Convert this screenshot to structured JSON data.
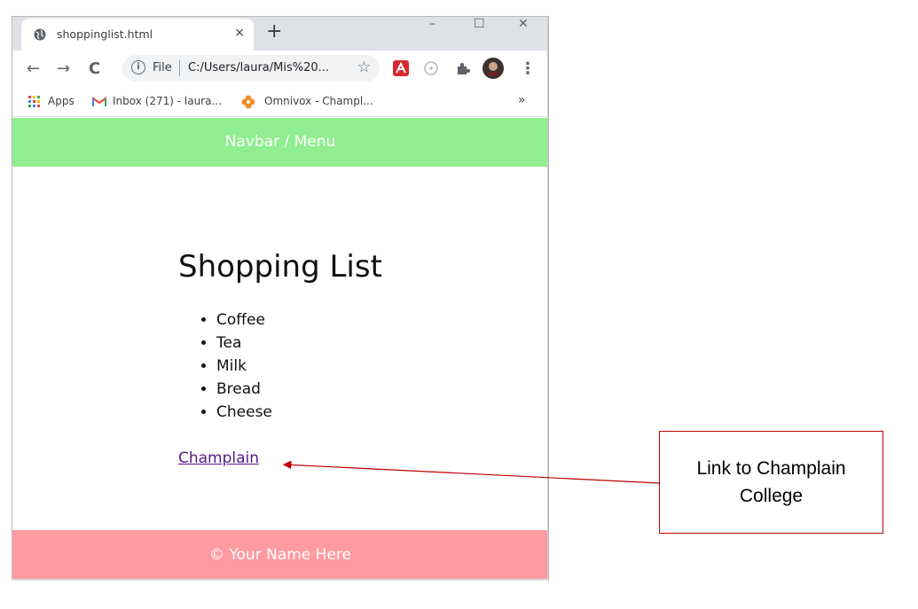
{
  "browser": {
    "tab_title": "shoppinglist.html",
    "tab_close": "×",
    "new_tab": "+",
    "window_controls": {
      "minimize": "–",
      "maximize": "☐",
      "close": "✕"
    },
    "nav": {
      "back": "←",
      "forward": "→",
      "reload": "C"
    },
    "omnibox": {
      "scheme_label": "File",
      "url": "C:/Users/laura/Mis%20...",
      "info_icon": "i",
      "star": "☆"
    },
    "menu": "⋮",
    "bookmarks": [
      {
        "label": "Apps",
        "icon": "apps-grid-icon"
      },
      {
        "label": "Inbox (271) - laura...",
        "icon": "gmail-icon"
      },
      {
        "label": "Omnivox - Champl...",
        "icon": "omnivox-icon"
      }
    ],
    "bookmarks_overflow": "»"
  },
  "page": {
    "navbar": "Navbar / Menu",
    "heading": "Shopping List",
    "items": [
      "Coffee",
      "Tea",
      "Milk",
      "Bread",
      "Cheese"
    ],
    "link": "Champlain",
    "footer": "© Your Name Here"
  },
  "annotation": {
    "text": "Link to Champlain College"
  },
  "colors": {
    "navbar_bg": "#90ee90",
    "footer_bg": "#ff9aa2",
    "link": "#551a8b",
    "annotation_border": "#c00000"
  }
}
